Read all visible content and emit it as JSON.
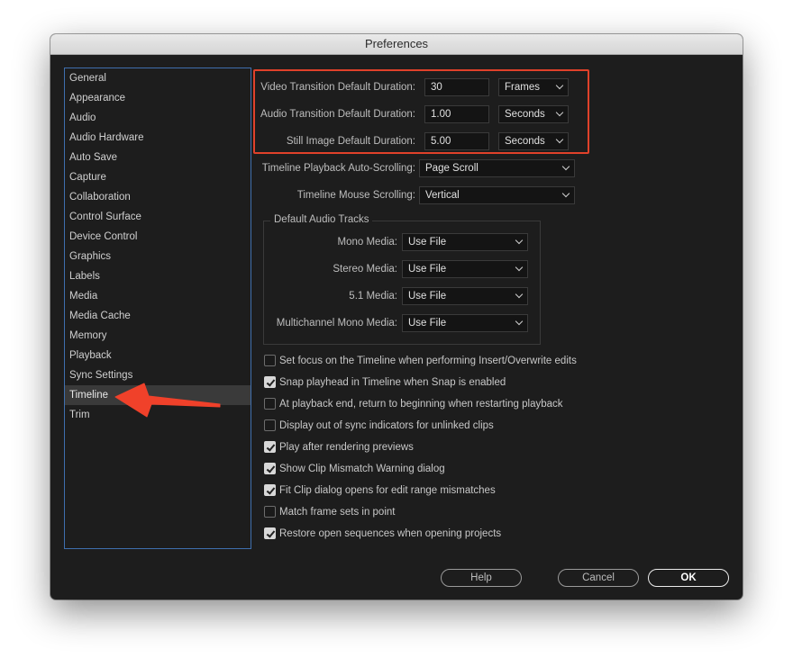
{
  "window": {
    "title": "Preferences"
  },
  "sidebar": {
    "items": [
      {
        "label": "General"
      },
      {
        "label": "Appearance"
      },
      {
        "label": "Audio"
      },
      {
        "label": "Audio Hardware"
      },
      {
        "label": "Auto Save"
      },
      {
        "label": "Capture"
      },
      {
        "label": "Collaboration"
      },
      {
        "label": "Control Surface"
      },
      {
        "label": "Device Control"
      },
      {
        "label": "Graphics"
      },
      {
        "label": "Labels"
      },
      {
        "label": "Media"
      },
      {
        "label": "Media Cache"
      },
      {
        "label": "Memory"
      },
      {
        "label": "Playback"
      },
      {
        "label": "Sync Settings"
      },
      {
        "label": "Timeline",
        "selected": true
      },
      {
        "label": "Trim"
      }
    ]
  },
  "durations": {
    "video": {
      "label": "Video Transition Default Duration:",
      "value": "30",
      "unit": "Frames"
    },
    "audio": {
      "label": "Audio Transition Default Duration:",
      "value": "1.00",
      "unit": "Seconds"
    },
    "still": {
      "label": "Still Image Default Duration:",
      "value": "5.00",
      "unit": "Seconds"
    }
  },
  "playback_scrolling": {
    "label": "Timeline Playback Auto-Scrolling:",
    "value": "Page Scroll"
  },
  "mouse_scrolling": {
    "label": "Timeline Mouse Scrolling:",
    "value": "Vertical"
  },
  "audio_tracks": {
    "title": "Default Audio Tracks",
    "mono": {
      "label": "Mono Media:",
      "value": "Use File"
    },
    "stereo": {
      "label": "Stereo Media:",
      "value": "Use File"
    },
    "surround": {
      "label": "5.1 Media:",
      "value": "Use File"
    },
    "multichannel": {
      "label": "Multichannel Mono Media:",
      "value": "Use File"
    }
  },
  "checkboxes": [
    {
      "label": "Set focus on the Timeline when performing Insert/Overwrite edits",
      "checked": false
    },
    {
      "label": "Snap playhead in Timeline when Snap is enabled",
      "checked": true
    },
    {
      "label": "At playback end, return to beginning when restarting playback",
      "checked": false
    },
    {
      "label": "Display out of sync indicators for unlinked clips",
      "checked": false
    },
    {
      "label": "Play after rendering previews",
      "checked": true
    },
    {
      "label": "Show Clip Mismatch Warning dialog",
      "checked": true
    },
    {
      "label": "Fit Clip dialog opens for edit range mismatches",
      "checked": true
    },
    {
      "label": "Match frame sets in point",
      "checked": false
    },
    {
      "label": "Restore open sequences when opening projects",
      "checked": true
    }
  ],
  "buttons": {
    "help": "Help",
    "cancel": "Cancel",
    "ok": "OK"
  },
  "colors": {
    "highlight": "#e0412a",
    "selection_border": "#3f6fae",
    "arrow": "#f0412a"
  }
}
